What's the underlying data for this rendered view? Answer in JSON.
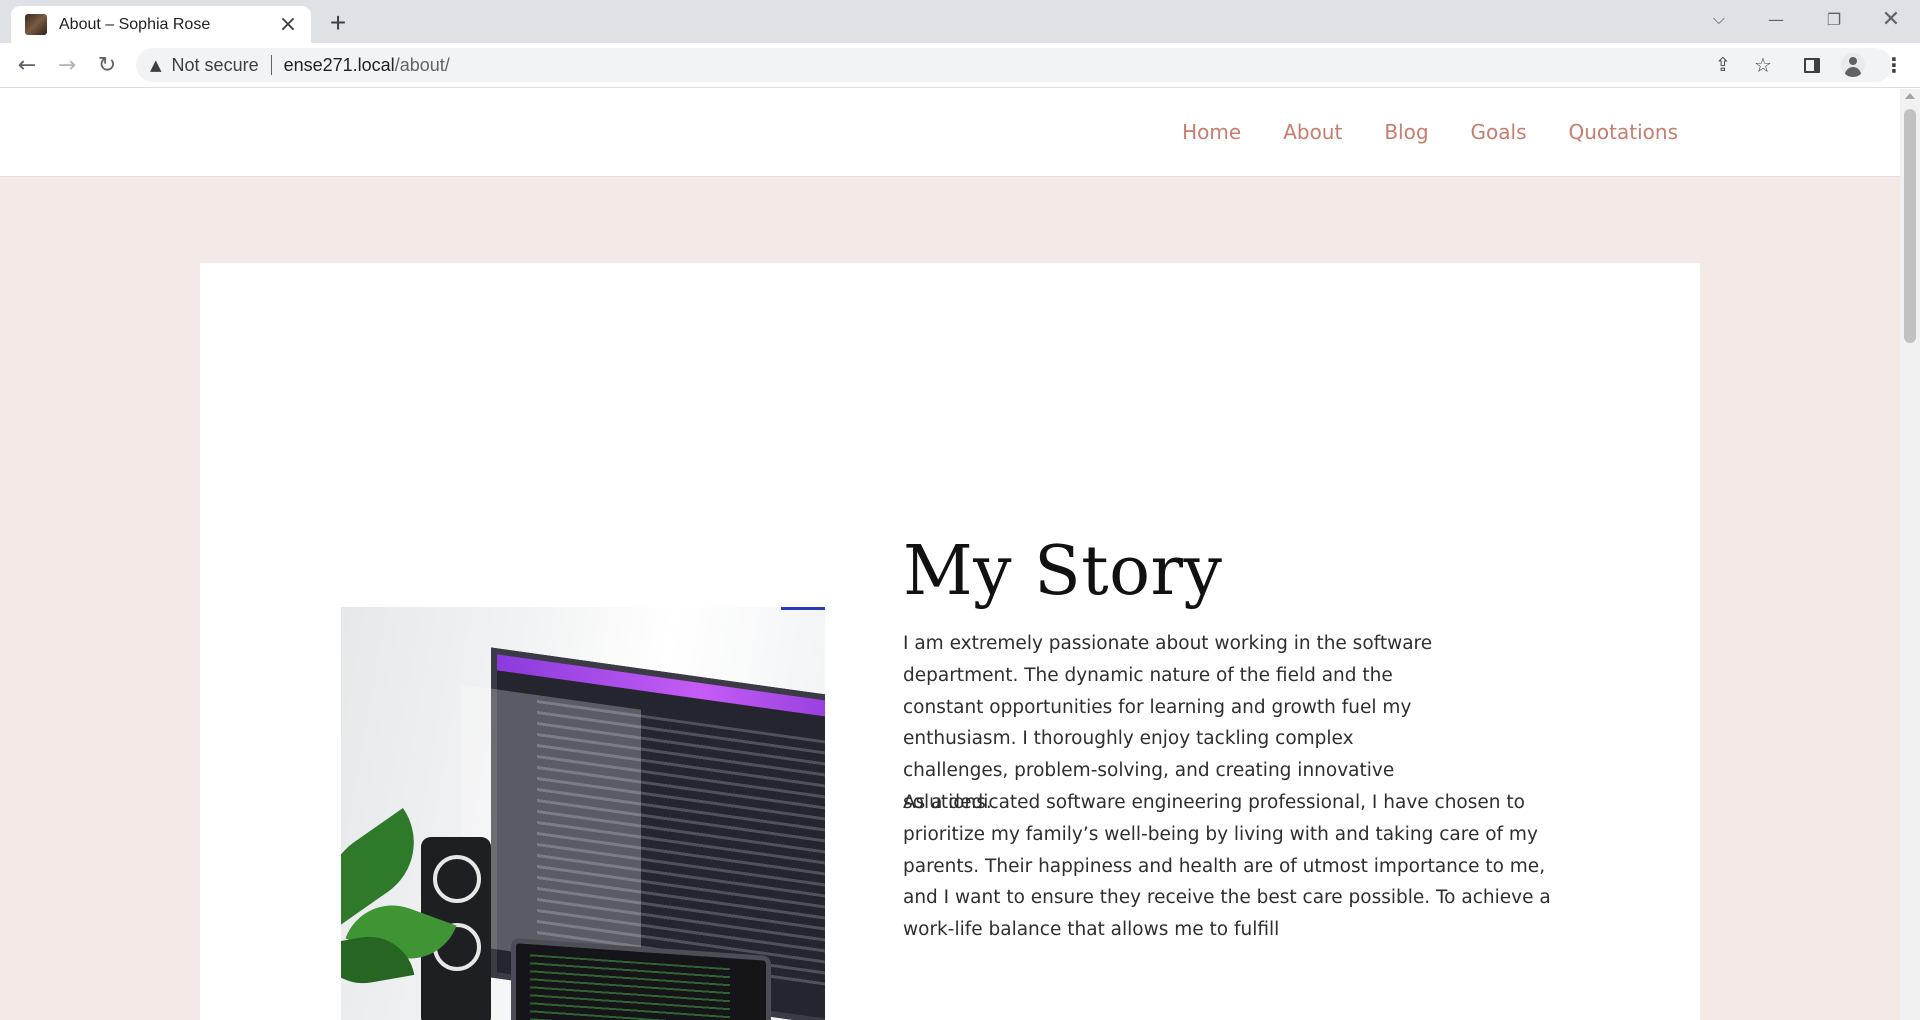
{
  "browser": {
    "tab_title": "About – Sophia Rose",
    "new_tab_symbol": "+",
    "security_label": "Not secure",
    "url_host": "ense271.local",
    "url_path": "/about/"
  },
  "nav": {
    "items": [
      {
        "label": "Home"
      },
      {
        "label": "About"
      },
      {
        "label": "Blog"
      },
      {
        "label": "Goals"
      },
      {
        "label": "Quotations"
      }
    ],
    "link_color": "#c77d6e"
  },
  "page": {
    "background_color": "#f3e9e6",
    "heading": "My Story",
    "paragraph1": "I am extremely passionate about working in the software department. The dynamic nature of the field and the constant opportunities for learning and growth fuel my enthusiasm. I thoroughly enjoy tackling complex challenges, problem-solving, and creating innovative solutions.",
    "paragraph2": "As a dedicated software engineering professional, I have chosen to prioritize my family’s well-being by living with and taking care of my parents. Their happiness and health are of utmost importance to me, and I want to ensure they receive the best care possible. To achieve a work-life balance that allows me to fulfill"
  },
  "icons": {
    "back": "arrow-left-icon",
    "forward": "arrow-right-icon",
    "reload": "reload-icon",
    "warning": "warning-icon",
    "share": "share-icon",
    "bookmark": "star-icon",
    "side_panel": "side-panel-icon",
    "profile": "profile-icon",
    "menu": "kebab-menu-icon"
  }
}
